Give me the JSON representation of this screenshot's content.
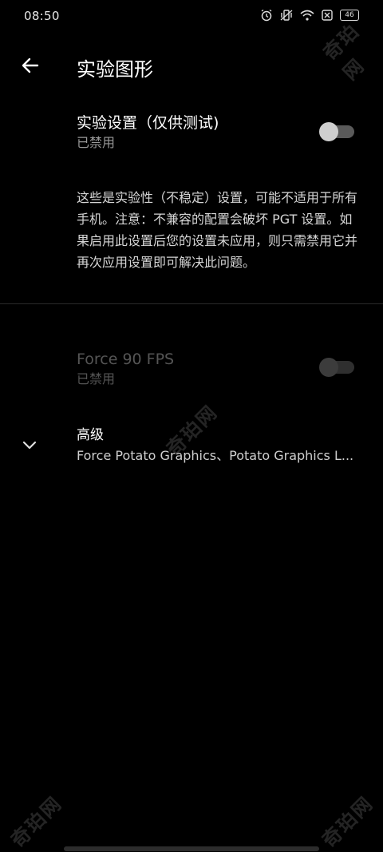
{
  "status_bar": {
    "time": "08:50",
    "battery": "46",
    "icons": [
      "alarm-icon",
      "vibrate-icon",
      "wifi-icon",
      "sim-off-icon",
      "battery-icon"
    ]
  },
  "app_bar": {
    "title": "实验图形",
    "back_icon": "arrow-left-icon"
  },
  "experimental_setting": {
    "title": "实验设置（仅供测试)",
    "summary": "已禁用",
    "enabled": false
  },
  "description": "这些是实验性（不稳定）设置，可能不适用于所有手机。注意：不兼容的配置会破坏 PGT 设置。如果启用此设置后您的设置未应用，则只需禁用它并再次应用设置即可解决此问题。",
  "force_fps": {
    "title": "Force 90 FPS",
    "summary": "已禁用",
    "enabled": false,
    "disabled": true
  },
  "advanced": {
    "title": "高级",
    "summary": "Force Potato Graphics、Potato Graphics L...",
    "icon": "chevron-down-icon"
  },
  "watermarks": {
    "text": "奇珀网"
  }
}
